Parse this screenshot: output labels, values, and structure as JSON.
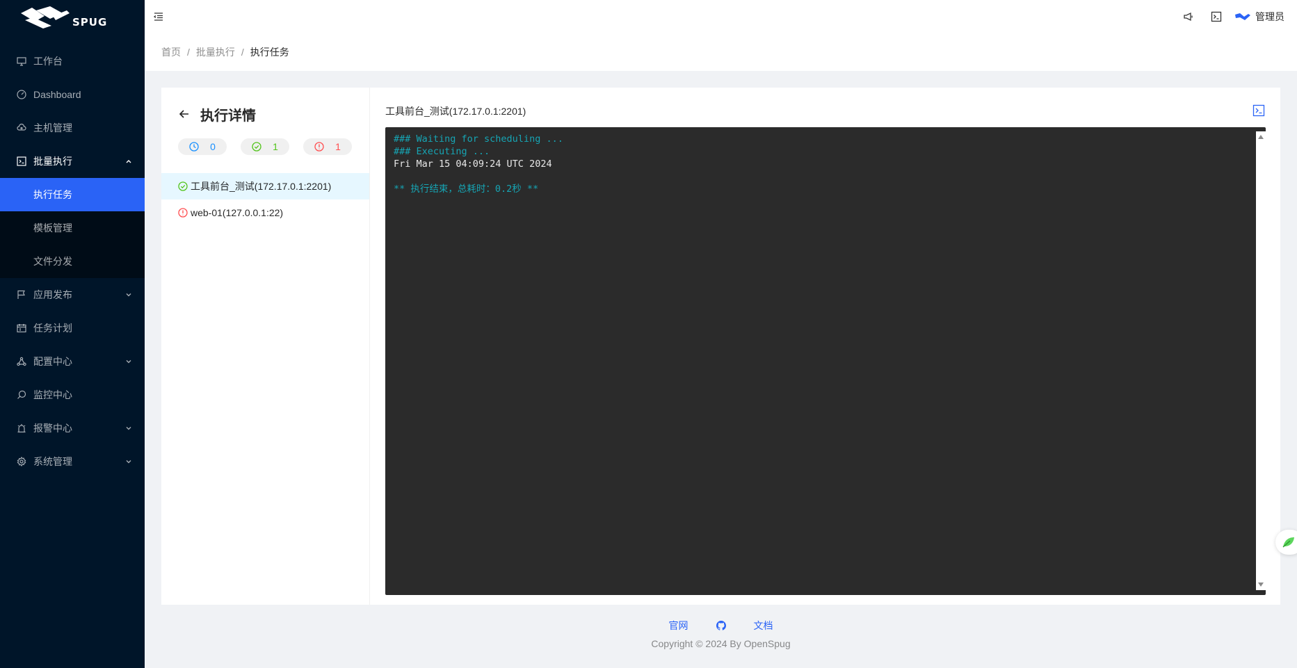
{
  "brand": {
    "logo_text": "SPUG"
  },
  "sidebar": {
    "items": [
      {
        "label": "工作台",
        "icon": "desktop-icon"
      },
      {
        "label": "Dashboard",
        "icon": "dashboard-icon"
      },
      {
        "label": "主机管理",
        "icon": "cloud-server-icon"
      },
      {
        "label": "批量执行",
        "icon": "code-icon",
        "expanded": true,
        "children": [
          {
            "label": "执行任务",
            "active": true
          },
          {
            "label": "模板管理"
          },
          {
            "label": "文件分发"
          }
        ]
      },
      {
        "label": "应用发布",
        "icon": "flag-icon"
      },
      {
        "label": "任务计划",
        "icon": "schedule-icon"
      },
      {
        "label": "配置中心",
        "icon": "deployment-unit-icon"
      },
      {
        "label": "监控中心",
        "icon": "monitor-icon"
      },
      {
        "label": "报警中心",
        "icon": "alert-icon"
      },
      {
        "label": "系统管理",
        "icon": "setting-icon"
      }
    ]
  },
  "header": {
    "user_name": "管理员",
    "icons": [
      "menu-fold-icon",
      "notification-icon",
      "terminal-icon",
      "user-avatar-icon"
    ]
  },
  "breadcrumb": {
    "items": [
      "首页",
      "批量执行",
      "执行任务"
    ]
  },
  "detail": {
    "title": "执行详情",
    "stats": {
      "pending": "0",
      "success": "1",
      "failed": "1"
    },
    "hosts": [
      {
        "name": "工具前台_测试(172.17.0.1:2201)",
        "status": "success",
        "selected": true
      },
      {
        "name": "web-01(127.0.0.1:22)",
        "status": "failed",
        "selected": false
      }
    ]
  },
  "output": {
    "host_title": "工具前台_测试(172.17.0.1:2201)",
    "lines": [
      "### Waiting for scheduling ...",
      "### Executing ...",
      "Fri Mar 15 04:09:24 UTC 2024",
      "",
      "** 执行结束，总耗时：0.2秒 **"
    ]
  },
  "footer": {
    "links": [
      "官网",
      "文档"
    ],
    "copyright": "Copyright © 2024 By OpenSpug"
  },
  "colors": {
    "sidebar_bg": "#001529",
    "accent": "#2a63f6",
    "terminal_bg": "#2b2b2b",
    "terminal_cyan": "#16a5b4",
    "success": "#52c41a",
    "error": "#ff4d4f",
    "pending": "#1890ff"
  }
}
